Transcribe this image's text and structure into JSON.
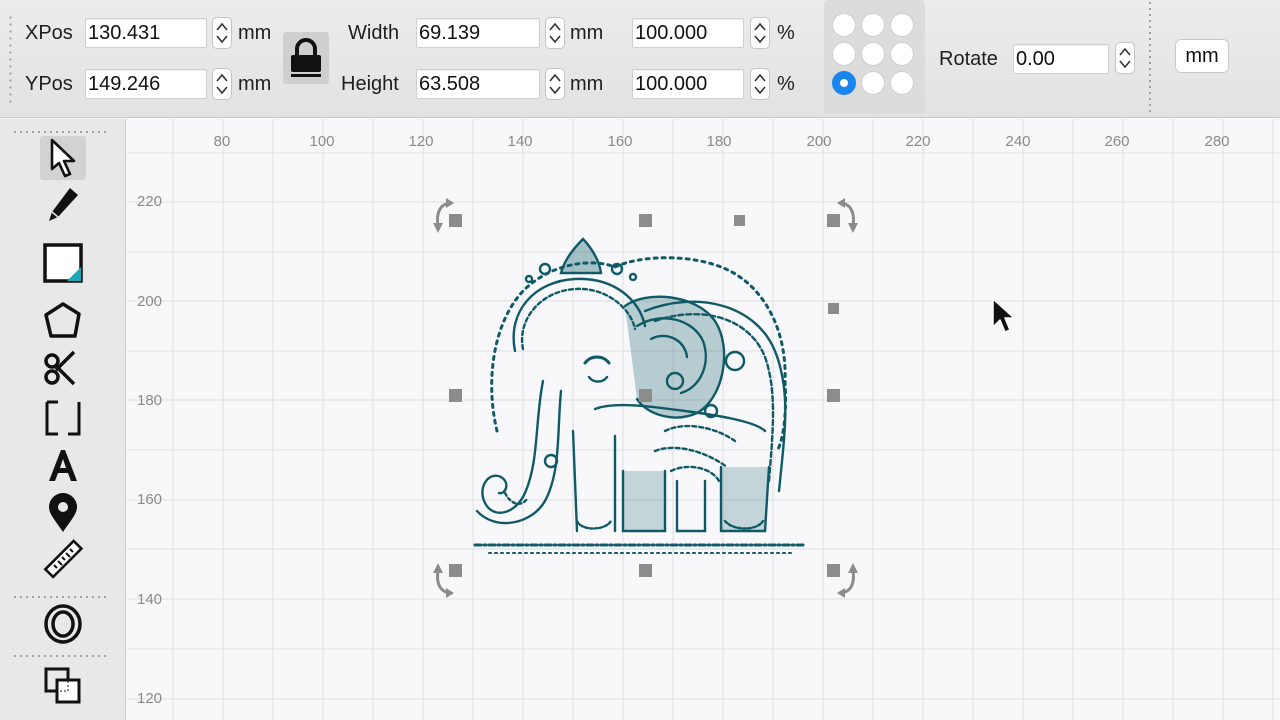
{
  "toolbar": {
    "xpos": {
      "label": "XPos",
      "value": "130.431",
      "unit": "mm"
    },
    "ypos": {
      "label": "YPos",
      "value": "149.246",
      "unit": "mm"
    },
    "width": {
      "label": "Width",
      "value": "69.139",
      "unit": "mm",
      "scale": "100.000",
      "scale_unit": "%"
    },
    "height": {
      "label": "Height",
      "value": "63.508",
      "unit": "mm",
      "scale": "100.000",
      "scale_unit": "%"
    },
    "rotate": {
      "label": "Rotate",
      "value": "0.00"
    },
    "units_button": "mm",
    "anchor_selected": "bottom-left"
  },
  "tools": [
    "select-arrow-icon",
    "pencil-icon",
    "rectangle-icon",
    "polygon-icon",
    "scissors-icon",
    "frame-icon",
    "text-icon",
    "location-pin-icon",
    "ruler-icon",
    "offset-icon",
    "boolean-icon"
  ],
  "ruler": {
    "x_labels": [
      "80",
      "100",
      "120",
      "140",
      "160",
      "180",
      "200",
      "220",
      "240",
      "260",
      "280"
    ],
    "y_labels": [
      "220",
      "200",
      "180",
      "160",
      "140",
      "120"
    ]
  },
  "colors": {
    "accent": "#1a84f0",
    "artwork": "#0f5a66",
    "handle": "#8c8c8c"
  }
}
